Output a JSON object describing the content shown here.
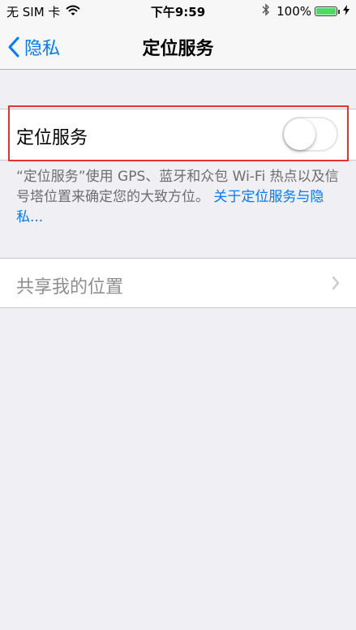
{
  "status_bar": {
    "carrier": "无 SIM 卡",
    "time": "下午9:59",
    "battery_text": "100%",
    "battery_level": 1.0,
    "battery_color": "#4cd964"
  },
  "nav": {
    "back_label": "隐私",
    "title": "定位服务",
    "accent_color": "#007aff"
  },
  "location_services": {
    "label": "定位服务",
    "enabled": false
  },
  "footer": {
    "text": "“定位服务”使用 GPS、蓝牙和众包 Wi-Fi 热点以及信号塔位置来确定您的大致方位。",
    "link": "关于定位服务与隐私..."
  },
  "share_location": {
    "label": "共享我的位置"
  },
  "icons": [
    "wifi-icon",
    "bluetooth-icon",
    "battery-icon",
    "charging-bolt-icon",
    "back-chevron-icon",
    "chevron-right-icon"
  ]
}
